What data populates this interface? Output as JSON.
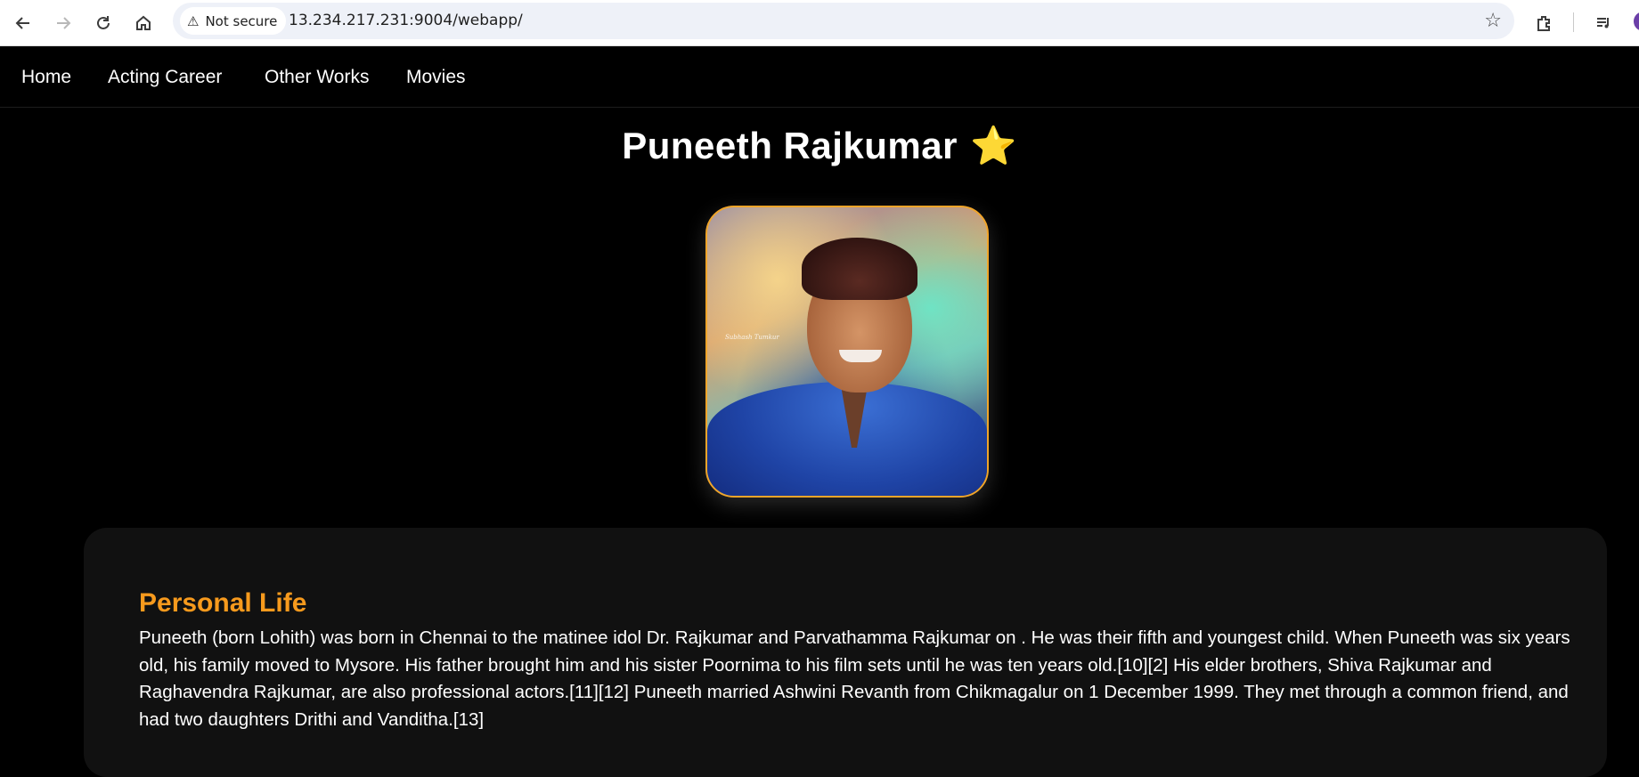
{
  "browser": {
    "security_label": "Not secure",
    "url": "13.234.217.231:9004/webapp/"
  },
  "nav": {
    "items": [
      {
        "label": "Home"
      },
      {
        "label": "Acting Career"
      },
      {
        "label": "Other Works"
      },
      {
        "label": "Movies"
      }
    ]
  },
  "page": {
    "title": "Puneeth Rajkumar",
    "title_icon": "⭐",
    "portrait_signature": "Subhash Tumkur"
  },
  "section": {
    "heading": "Personal Life",
    "body": "Puneeth (born Lohith) was born in Chennai to the matinee idol Dr. Rajkumar and Parvathamma Rajkumar on . He was their fifth and youngest child. When Puneeth was six years old, his family moved to Mysore. His father brought him and his sister Poornima to his film sets until he was ten years old.[10][2] His elder brothers, Shiva Rajkumar and Raghavendra Rajkumar, are also professional actors.[11][12] Puneeth married Ashwini Revanth from Chikmagalur on 1 December 1999. They met through a common friend, and had two daughters Drithi and Vanditha.[13]"
  },
  "colors": {
    "accent_orange": "#f79a1d",
    "portrait_border": "#f0a52a",
    "background": "#000000",
    "card": "#111111"
  }
}
